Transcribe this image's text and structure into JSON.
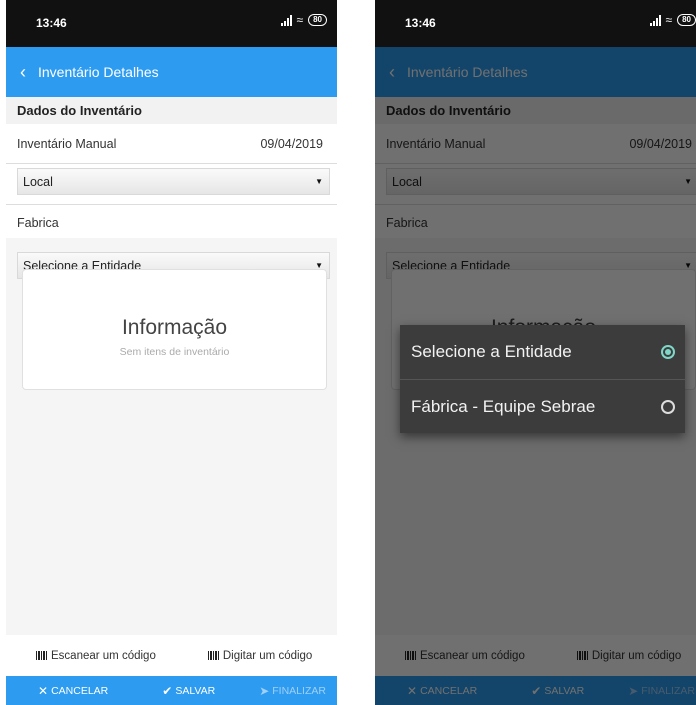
{
  "status": {
    "time": "13:46",
    "battery": "80"
  },
  "header": {
    "title": "Inventário Detalhes"
  },
  "section": {
    "title": "Dados do Inventário"
  },
  "inventory": {
    "name": "Inventário Manual",
    "date": "09/04/2019"
  },
  "local_select": {
    "value": "Local"
  },
  "location": {
    "label": "Fabrica"
  },
  "entity_select": {
    "value": "Selecione a Entidade"
  },
  "info_card": {
    "title": "Informação",
    "subtitle": "Sem itens de inventário"
  },
  "scan": {
    "scan_label": "Escanear um código",
    "type_label": "Digitar um código"
  },
  "actions": {
    "cancel": "CANCELAR",
    "save": "SALVAR",
    "finish": "FINALIZAR"
  },
  "dialog": {
    "options": [
      {
        "label": "Selecione a Entidade",
        "selected": true
      },
      {
        "label": "Fábrica - Equipe Sebrae",
        "selected": false
      }
    ]
  },
  "colors": {
    "primary": "#2d9bf0",
    "radio_accent": "#7fd7c8",
    "dialog_bg": "#3c3c3c"
  }
}
